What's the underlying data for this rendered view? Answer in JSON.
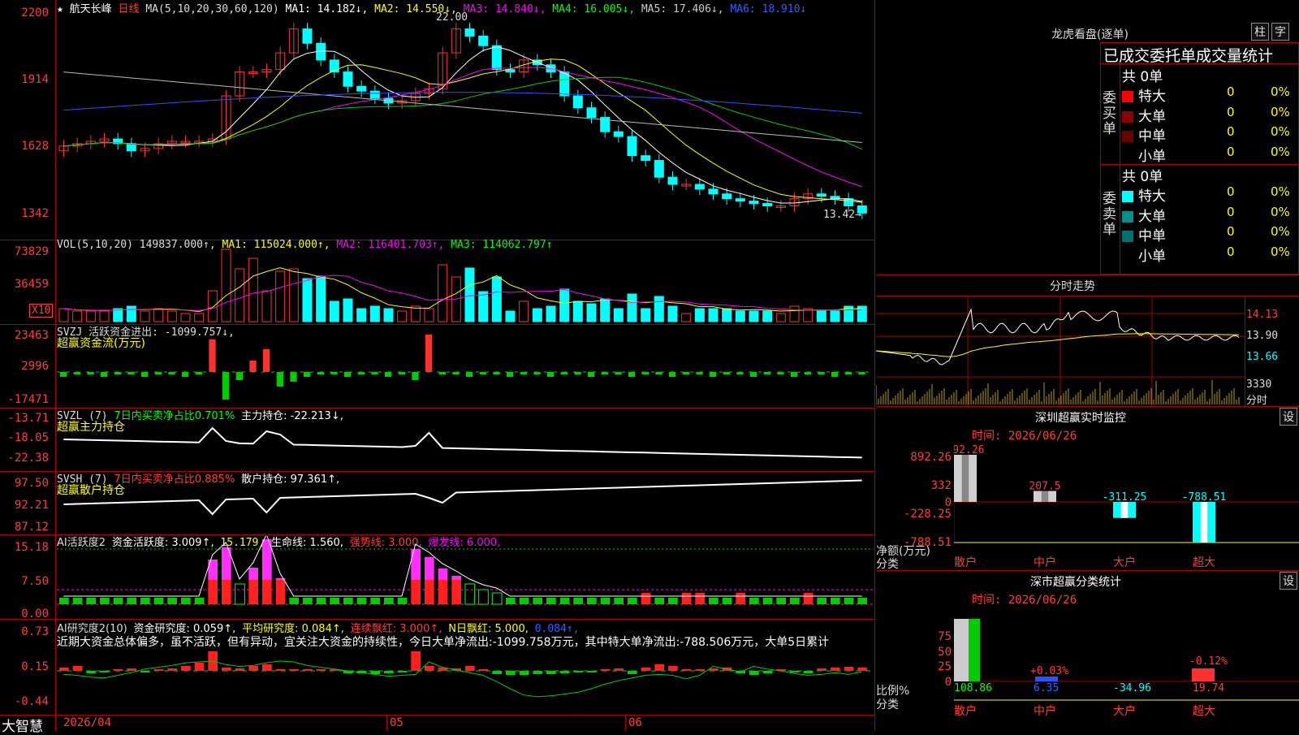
{
  "stock": {
    "star": "★",
    "name": "航天长峰",
    "period": "日线",
    "ma_params": "MA(5,10,20,30,60,120)",
    "ma1": "MA1: 14.182↓,",
    "ma2": "MA2: 14.550↓,",
    "ma3": "MA3: 14.840↓,",
    "ma4": "MA4: 16.005↓,",
    "ma5": "MA5: 17.406↓,",
    "ma6": "MA6: 18.910↓",
    "high_mark": "22.00",
    "low_mark": "13.42→"
  },
  "price_axis": [
    "2200",
    "1914",
    "1628",
    "1342"
  ],
  "vol": {
    "header": "VOL(5,10,20) 149837.000↑,",
    "ma1": "MA1: 115024.000↑,",
    "ma2": "MA2: 116401.703↑,",
    "ma3": "MA3: 114062.797↑",
    "axis": [
      "73829",
      "36459"
    ],
    "unit": "X10"
  },
  "svzj": {
    "header": "SVZJ  活跃资金进出: -1099.757↓,",
    "sub": "超赢资金流(万元)",
    "axis": [
      "23463",
      "2996",
      "-17471"
    ]
  },
  "svzl": {
    "name": "SVZL (7)",
    "ratio": "7日内买卖净占比0.701%",
    "hold": "主力持仓: -22.213↓,",
    "sub": "超赢主力持仓",
    "axis": [
      "-13.71",
      "-18.05",
      "-22.38"
    ]
  },
  "svsh": {
    "name": "SVSH (7)",
    "ratio": "7日内买卖净占比0.885%",
    "hold": "散户持仓: 97.361↑,",
    "sub": "超赢散户持仓",
    "axis": [
      "97.50",
      "92.21",
      "87.12"
    ]
  },
  "ai2": {
    "name": "AI活跃度2",
    "act": "资金活跃度: 3.009↑,",
    "v2": "15.179,",
    "life": "生命线: 1.560,",
    "strong": "强势线: 3.000,",
    "burst": "爆发线: 6.000,",
    "axis": [
      "15.18",
      "7.50",
      "0.00"
    ]
  },
  "ai_research": {
    "name": "AI研究度2(10)",
    "fund": "资金研究度: 0.059↑,",
    "avg": "平均研究度: 0.084↑,",
    "red": "连续飘红: 3.000↑,",
    "nred": "N日飘红: 5.000,",
    "v": "0.084↑,",
    "commentary": "近期大资金总体偏多，虽不活跃，但有异动，宜关注大资金的持续性，今日大单净流出:-1099.758万元，其中特大单净流出:-788.506万元，大单5日累计",
    "axis": [
      "0.73",
      "0.15",
      "-0.44"
    ]
  },
  "x_axis": [
    "2026/04",
    "05",
    "06"
  ],
  "brand": "大智慧",
  "right": {
    "dragon_title": "龙虎看盘(逐单)",
    "btn_bar": "柱",
    "btn_grid": "字",
    "stat_title": "已成交委托单成交量统计",
    "buy_label": "委买单",
    "sell_label": "委卖单",
    "buy_total": "共 0单",
    "sell_total": "共 0单",
    "buy_rows": [
      {
        "label": "特大",
        "count": "0",
        "pct": "0%",
        "color": "#ff0000"
      },
      {
        "label": "大单",
        "count": "0",
        "pct": "0%",
        "color": "#8b0000"
      },
      {
        "label": "中单",
        "count": "0",
        "pct": "0%",
        "color": "#6b0000"
      },
      {
        "label": "小单",
        "count": "0",
        "pct": "0%",
        "color": "#000000"
      }
    ],
    "sell_rows": [
      {
        "label": "特大",
        "count": "0",
        "pct": "0%",
        "color": "#00ffff"
      },
      {
        "label": "大单",
        "count": "0",
        "pct": "0%",
        "color": "#009090"
      },
      {
        "label": "中单",
        "count": "0",
        "pct": "0%",
        "color": "#007070"
      },
      {
        "label": "小单",
        "count": "0",
        "pct": "0%",
        "color": "#000000"
      }
    ],
    "intraday_title": "分时走势",
    "intraday_axis": [
      "14.13",
      "13.90",
      "13.66"
    ],
    "intraday_vol": "3330",
    "intraday_vol_label": "分时",
    "sz_title": "深圳超赢实时监控",
    "sz_btn": "设",
    "sz_time": "时间: 2026/06/26",
    "sz_axis": [
      "892.26",
      "332",
      "0",
      "-228.25",
      "-788.51"
    ],
    "sz_ylabel": "净额(万元)",
    "sz_xlabel": "分类",
    "sz_cats": [
      "散户",
      "中户",
      "大户",
      "超大"
    ],
    "sz_values": [
      892.26,
      207.5,
      -311.25,
      -788.51
    ],
    "sz_value_labels": [
      "892.26",
      "207.5",
      "-311.25",
      "-788.51"
    ],
    "cls_title": "深市超赢分类统计",
    "cls_btn": "设",
    "cls_time": "时间: 2026/06/26",
    "cls_axis": [
      "75",
      "50",
      "25",
      "0"
    ],
    "cls_ylabel": "比例%",
    "cls_xlabel": "分类",
    "cls_cats": [
      "散户",
      "中户",
      "大户",
      "超大"
    ],
    "cls_pcts": [
      "",
      "+0.03%",
      "",
      "-0.12%"
    ],
    "cls_values": [
      "108.86",
      "6.35",
      "-34.96",
      "19.74"
    ]
  },
  "chart_data": {
    "type": "candlestick",
    "count": 60,
    "close": [
      16.7,
      16.8,
      16.9,
      17.0,
      16.8,
      16.5,
      16.6,
      16.8,
      16.9,
      16.9,
      16.9,
      17.0,
      18.8,
      19.8,
      19.8,
      19.9,
      20.6,
      21.6,
      21.0,
      20.3,
      19.8,
      19.2,
      19.0,
      18.7,
      18.5,
      18.6,
      18.9,
      19.1,
      20.6,
      21.6,
      21.3,
      20.9,
      19.9,
      19.8,
      20.3,
      20.1,
      19.8,
      18.8,
      18.3,
      17.9,
      17.3,
      17.1,
      16.3,
      16.1,
      15.4,
      15.1,
      15.1,
      14.9,
      14.7,
      14.5,
      14.4,
      14.3,
      14.2,
      14.2,
      14.5,
      14.7,
      14.6,
      14.5,
      14.2,
      13.9
    ]
  }
}
